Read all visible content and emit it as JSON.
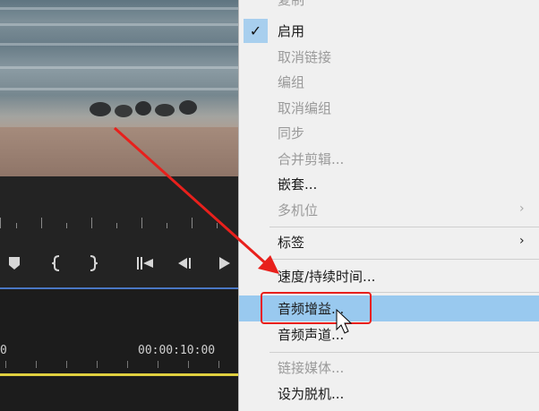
{
  "menu": {
    "cut_top_label": "复制",
    "items": [
      {
        "label": "启用",
        "checked": true,
        "disabled": false
      },
      {
        "label": "取消链接",
        "disabled": true
      },
      {
        "label": "编组",
        "disabled": true
      },
      {
        "label": "取消编组",
        "disabled": true
      },
      {
        "label": "同步",
        "disabled": true
      },
      {
        "label": "合并剪辑...",
        "disabled": true
      },
      {
        "label": "嵌套...",
        "disabled": false
      },
      {
        "label": "多机位",
        "disabled": true,
        "submenu": true
      },
      {
        "label": "标签",
        "disabled": false,
        "submenu": true
      },
      {
        "label": "速度/持续时间...",
        "disabled": false
      },
      {
        "label": "音频增益...",
        "disabled": false,
        "highlighted": true
      },
      {
        "label": "音频声道...",
        "disabled": false
      },
      {
        "label": "链接媒体...",
        "disabled": true
      },
      {
        "label": "设为脱机...",
        "disabled": false
      }
    ],
    "submenu_arrow": "›",
    "checkmark": "✓"
  },
  "timeline": {
    "timecode_start": "0",
    "timecode_mark": "00:00:10:00"
  },
  "colors": {
    "highlight": "#99c9ef",
    "annotation_red": "#e8201c",
    "timeline_blue": "#4a77c4",
    "timeline_yellow": "#dfcf3f"
  },
  "icons": [
    "marker-icon",
    "in-point-icon",
    "out-point-icon",
    "go-to-in-icon",
    "step-back-icon",
    "play-icon",
    "mouse-cursor-icon"
  ]
}
